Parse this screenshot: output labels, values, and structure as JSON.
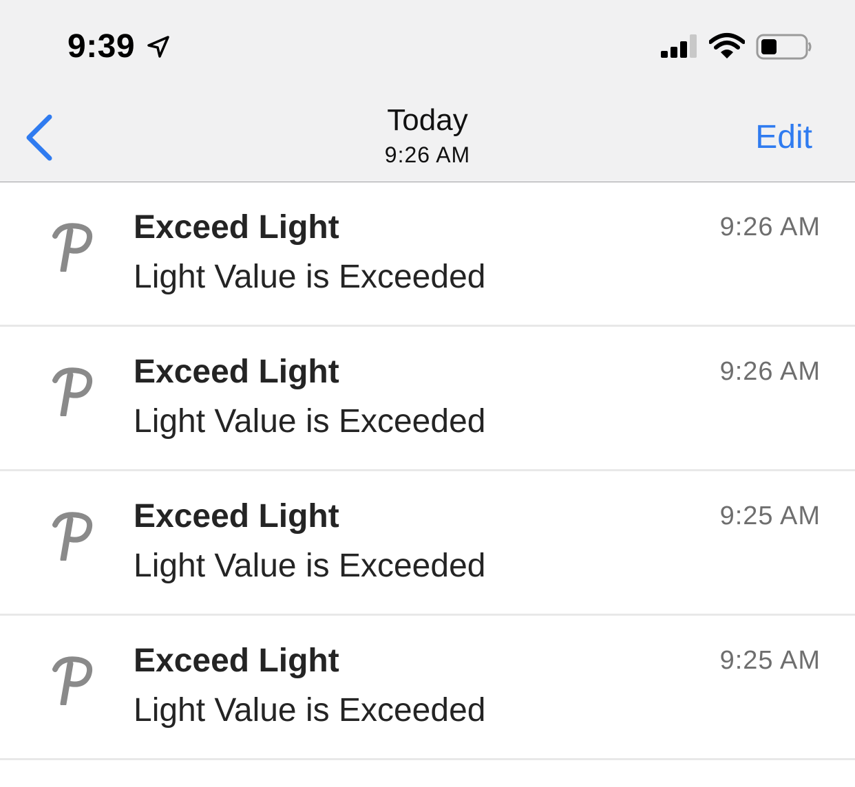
{
  "status_bar": {
    "time": "9:39",
    "icons": [
      "location-arrow-icon",
      "cellular-signal-icon",
      "wifi-icon",
      "battery-icon"
    ]
  },
  "nav": {
    "back_icon": "chevron-left-icon",
    "title": "Today",
    "subtitle": "9:26 AM",
    "edit_label": "Edit",
    "accent_color": "#2f7bf0"
  },
  "notifications": [
    {
      "icon": "app-p-logo-icon",
      "title": "Exceed Light",
      "body": "Light Value is Exceeded",
      "time": "9:26 AM"
    },
    {
      "icon": "app-p-logo-icon",
      "title": "Exceed Light",
      "body": "Light Value is Exceeded",
      "time": "9:26 AM"
    },
    {
      "icon": "app-p-logo-icon",
      "title": "Exceed Light",
      "body": "Light Value is Exceeded",
      "time": "9:25 AM"
    },
    {
      "icon": "app-p-logo-icon",
      "title": "Exceed Light",
      "body": "Light Value is Exceeded",
      "time": "9:25 AM"
    }
  ]
}
